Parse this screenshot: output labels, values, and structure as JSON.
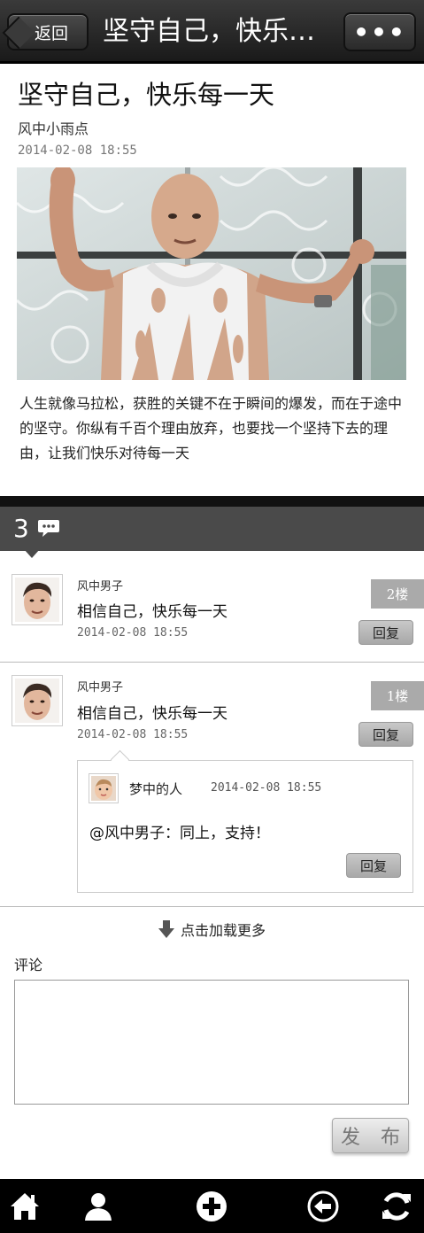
{
  "header": {
    "back_label": "返回",
    "title": "坚守自己，快乐每一天",
    "more_label": "•••"
  },
  "article": {
    "title": "坚守自己，快乐每一天",
    "author": "风中小雨点",
    "date": "2014-02-08 18:55",
    "image_alt": "photo-of-man-in-torn-white-vest",
    "body": "人生就像马拉松，获胜的关键不在于瞬间的爆发，而在于途中的坚守。你纵有千百个理由放弃，也要找一个坚持下去的理由，让我们快乐对待每一天"
  },
  "comments_header": {
    "count": "3",
    "icon": "speech-bubble-icon"
  },
  "comments": [
    {
      "user": "风中男子",
      "text": "相信自己，快乐每一天",
      "date": "2014-02-08 18:55",
      "floor": "2楼",
      "reply_label": "回复"
    },
    {
      "user": "风中男子",
      "text": "相信自己，快乐每一天",
      "date": "2014-02-08 18:55",
      "floor": "1楼",
      "reply_label": "回复",
      "sub_reply": {
        "user": "梦中的人",
        "date": "2014-02-08 18:55",
        "text": "@风中男子：同上，支持！",
        "reply_label": "回复"
      }
    }
  ],
  "load_more_label": "点击加载更多",
  "comment_form": {
    "label": "评论",
    "placeholder": "",
    "value": "",
    "submit_label": "发 布"
  },
  "toolbar": {
    "icons": [
      "home-icon",
      "user-icon",
      "add-icon",
      "back-arrow-icon",
      "refresh-icon"
    ]
  },
  "colors": {
    "header_bg": "#2a2a2a",
    "comment_bar_bg": "#4a4a4a",
    "floor_badge_bg": "#aaaaaa",
    "bottom_bar_bg": "#000000"
  }
}
